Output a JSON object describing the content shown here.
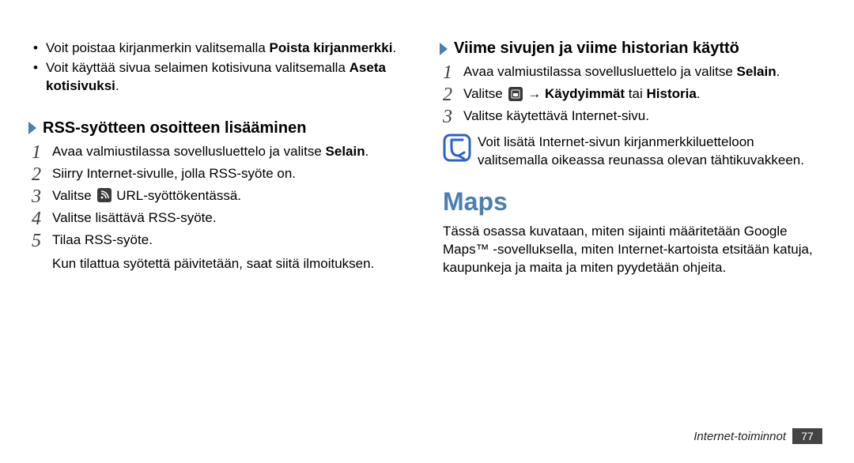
{
  "left": {
    "bullets": [
      {
        "pre": "Voit poistaa kirjanmerkin valitsemalla ",
        "bold": "Poista kirjanmerkki",
        "post": "."
      },
      {
        "pre": "Voit käyttää sivua selaimen kotisivuna valitsemalla ",
        "bold": "Aseta kotisivuksi",
        "post": "."
      }
    ],
    "heading": "RSS-syötteen osoitteen lisääminen",
    "steps": [
      {
        "num": "1",
        "pre": "Avaa valmiustilassa sovellusluettelo ja valitse ",
        "bold": "Selain",
        "post": "."
      },
      {
        "num": "2",
        "text": "Siirry Internet-sivulle, jolla RSS-syöte on."
      },
      {
        "num": "3",
        "pre": "Valitse ",
        "icon": "rss",
        "post": " URL-syöttökentässä."
      },
      {
        "num": "4",
        "text": "Valitse lisättävä RSS-syöte."
      },
      {
        "num": "5",
        "text": "Tilaa RSS-syöte."
      }
    ],
    "after_steps": "Kun tilattua syötettä päivitetään, saat siitä ilmoituksen."
  },
  "right": {
    "heading": "Viime sivujen ja viime historian käyttö",
    "steps": [
      {
        "num": "1",
        "pre": "Avaa valmiustilassa sovellusluettelo ja valitse ",
        "bold": "Selain",
        "post": "."
      },
      {
        "num": "2",
        "pre": "Valitse ",
        "icon": "recent",
        "mid": " → ",
        "bold": "Käydyimmät",
        "mid2": " tai ",
        "bold2": "Historia",
        "post": "."
      },
      {
        "num": "3",
        "text": "Valitse käytettävä Internet-sivu."
      }
    ],
    "info": "Voit lisätä Internet-sivun kirjanmerkkiluetteloon valitsemalla oikeassa reunassa olevan tähtikuvakkeen.",
    "section_title": "Maps",
    "body": "Tässä osassa kuvataan, miten sijainti määritetään Google Maps™ -sovelluksella, miten Internet-kartoista etsitään katuja, kaupunkeja ja maita ja miten pyydetään ohjeita."
  },
  "footer": {
    "label": "Internet-toiminnot",
    "page": "77"
  }
}
